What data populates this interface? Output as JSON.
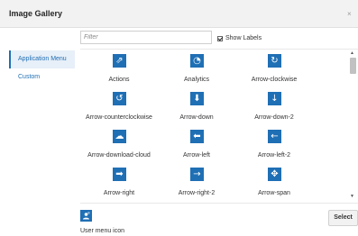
{
  "dialog": {
    "title": "Image Gallery",
    "close_glyph": "×"
  },
  "sidebar": {
    "items": [
      {
        "label": "Application Menu",
        "active": true
      },
      {
        "label": "Custom",
        "active": false
      }
    ]
  },
  "toolbar": {
    "filter_placeholder": "Filter",
    "filter_value": "",
    "show_labels": "Show Labels",
    "show_labels_checked": true
  },
  "gallery": {
    "icons": [
      {
        "label": "Actions",
        "icon": "share-export-icon",
        "glyph": "⇗"
      },
      {
        "label": "Analytics",
        "icon": "analytics-gauge-icon",
        "glyph": "◔"
      },
      {
        "label": "Arrow-clockwise",
        "icon": "arrow-clockwise-icon",
        "glyph": "↻"
      },
      {
        "label": "Arrow-counterclockwise",
        "icon": "arrow-counterclockwise-icon",
        "glyph": "↺"
      },
      {
        "label": "Arrow-down",
        "icon": "arrow-down-icon",
        "glyph": "⬇"
      },
      {
        "label": "Arrow-down-2",
        "icon": "arrow-down-2-icon",
        "glyph": "↓"
      },
      {
        "label": "Arrow-download-cloud",
        "icon": "cloud-download-icon",
        "glyph": "☁"
      },
      {
        "label": "Arrow-left",
        "icon": "arrow-left-icon",
        "glyph": "⬅"
      },
      {
        "label": "Arrow-left-2",
        "icon": "arrow-left-2-icon",
        "glyph": "←"
      },
      {
        "label": "Arrow-right",
        "icon": "arrow-right-icon",
        "glyph": "➡"
      },
      {
        "label": "Arrow-right-2",
        "icon": "arrow-right-2-icon",
        "glyph": "→"
      },
      {
        "label": "Arrow-span",
        "icon": "arrow-span-icon",
        "glyph": "✥"
      }
    ]
  },
  "selected": {
    "label": "User menu icon",
    "icon": "user-menu-icon"
  },
  "actions": {
    "select_label": "Select"
  },
  "colors": {
    "accent": "#1f6fb5",
    "titlebar": "#f2f2f2",
    "active_item_bg": "#e7eff8"
  }
}
